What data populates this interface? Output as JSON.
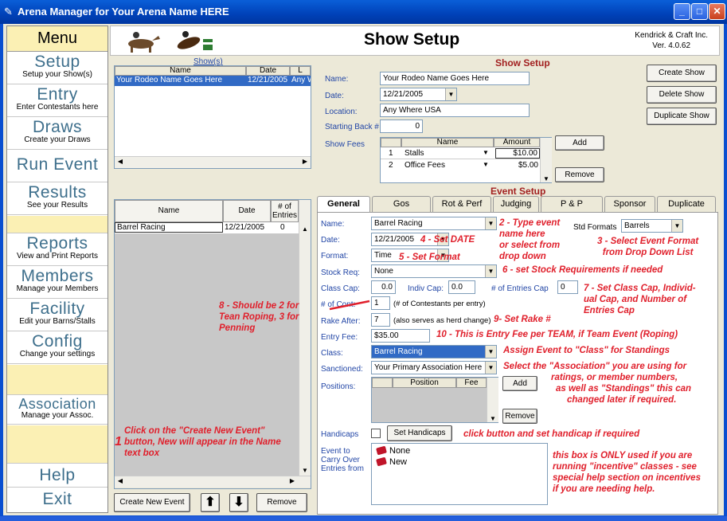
{
  "window": {
    "title": "Arena Manager for Your Arena Name HERE",
    "buttons": [
      "_",
      "□",
      "✕"
    ]
  },
  "menu": {
    "header": "Menu",
    "items": [
      {
        "big": "Setup",
        "small": "Setup your Show(s)"
      },
      {
        "big": "Entry",
        "small": "Enter Contestants here"
      },
      {
        "big": "Draws",
        "small": "Create your Draws"
      },
      {
        "big": "Run Event",
        "small": ""
      },
      {
        "big": "Results",
        "small": "See your Results"
      },
      {
        "big": "Reports",
        "small": "View and Print Reports"
      },
      {
        "big": "Members",
        "small": "Manage your Members"
      },
      {
        "big": "Facility",
        "small": "Edit your Barns/Stalls"
      },
      {
        "big": "Config",
        "small": "Change your settings"
      },
      {
        "big": "Association",
        "small": "Manage your Assoc."
      },
      {
        "big": "Help",
        "small": ""
      },
      {
        "big": "Exit",
        "small": ""
      }
    ]
  },
  "header": {
    "title": "Show Setup",
    "vendor": "Kendrick & Craft Inc.",
    "version": "Ver. 4.0.62"
  },
  "shows": {
    "caption": "Show(s)",
    "columns": [
      "Name",
      "Date",
      "L"
    ],
    "rows": [
      {
        "name": "Your Rodeo Name Goes Here",
        "date": "12/21/2005",
        "loc": "Any W"
      }
    ]
  },
  "show_setup": {
    "title": "Show Setup",
    "name_label": "Name:",
    "name_value": "Your Rodeo Name Goes Here",
    "date_label": "Date:",
    "date_value": "12/21/2005",
    "location_label": "Location:",
    "location_value": "Any Where USA",
    "back_label": "Starting Back #",
    "back_value": "0",
    "fees_label": "Show Fees",
    "fees_columns": [
      "Name",
      "Amount"
    ],
    "fees": [
      {
        "n": "1",
        "name": "Stalls",
        "amount": "$10.00"
      },
      {
        "n": "2",
        "name": "Office Fees",
        "amount": "$5.00"
      }
    ],
    "add_label": "Add",
    "remove_label": "Remove",
    "create_show": "Create Show",
    "delete_show": "Delete Show",
    "duplicate_show": "Duplicate Show"
  },
  "events": {
    "columns": [
      "Name",
      "Date",
      "# of\nEntries"
    ],
    "col_name": "Name",
    "col_date": "Date",
    "col_entries_1": "# of",
    "col_entries_2": "Entries",
    "rows": [
      {
        "name": "Barrel Racing",
        "date": "12/21/2005",
        "entries": "0"
      }
    ],
    "create_new_event": "Create New Event",
    "up_arrow": "⬆",
    "down_arrow": "⬇",
    "remove": "Remove"
  },
  "event_setup": {
    "title": "Event Setup",
    "tabs": [
      "General",
      "Gos",
      "Rot & Perf",
      "Judging",
      "P & P",
      "Sponsor",
      "Duplicate"
    ],
    "name_label": "Name:",
    "name_value": "Barrel Racing",
    "std_formats_label": "Std Formats",
    "std_formats_value": "Barrels",
    "date_label": "Date:",
    "date_value": "12/21/2005",
    "format_label": "Format:",
    "format_value": "Time",
    "stock_label": "Stock Req:",
    "stock_value": "None",
    "class_cap_label": "Class Cap:",
    "class_cap_value": "0.0",
    "indiv_cap_label": "Indiv Cap:",
    "indiv_cap_value": "0.0",
    "entries_cap_label": "# of Entries Cap",
    "entries_cap_value": "0",
    "cont_label": "# of Cont:",
    "cont_value": "1",
    "cont_note": "(# of Contestants per entry)",
    "rake_label": "Rake After:",
    "rake_value": "7",
    "rake_note": "(also serves as herd change)",
    "fee_label": "Entry Fee:",
    "fee_value": "$35.00",
    "class_label": "Class:",
    "class_value": "Barrel Racing",
    "sanctioned_label": "Sanctioned:",
    "sanctioned_value": "Your Primary Association Here",
    "positions_label": "Positions:",
    "positions_columns": [
      "Position",
      "Fee"
    ],
    "pos_add": "Add",
    "pos_remove": "Remove",
    "handicaps_label": "Handicaps",
    "set_handicaps": "Set Handicaps",
    "carry_label_1": "Event to",
    "carry_label_2": "Carry Over",
    "carry_label_3": "Entries from",
    "carry_items": [
      "None",
      "New"
    ]
  },
  "annotations": {
    "a1_num": "1",
    "a1": [
      "Click on the \"Create New Event\"",
      "button, New will appear in the Name",
      "text box"
    ],
    "a2": [
      "2 - Type event",
      "name here",
      "or select from",
      "drop down"
    ],
    "a3": [
      "3 - Select Event Format",
      "from Drop Down List"
    ],
    "a4": "4 - Set DATE",
    "a5": "5 - Set Format",
    "a6": "6 - set Stock Requirements if needed",
    "a7": [
      "7 - Set Class Cap, Individ-",
      "ual Cap, and  Number of",
      "Entries Cap"
    ],
    "a8": [
      "8 - Should be 2 for",
      "Tean Roping, 3 for",
      "Penning"
    ],
    "a9": "9- Set Rake #",
    "a10": "10 - This is Entry Fee per TEAM, if Team Event (Roping)",
    "a11": "Assign Event to \"Class\" for  Standings",
    "a12": [
      "Select the \"Association\" you are using for",
      "ratings, or member numbers,",
      "as well as \"Standings\" this can",
      "changed later if  required."
    ],
    "a13": "click button and set handicap if required",
    "a14": [
      "this box is ONLY used if you are",
      "running \"incentive\"  classes - see",
      "special help section on incentives",
      "if you are needing help."
    ]
  },
  "colors": {
    "titlebar": "#0041b8",
    "annotation": "#e0202c",
    "label": "#2246a6",
    "menu_bg": "#fbf0b4"
  }
}
